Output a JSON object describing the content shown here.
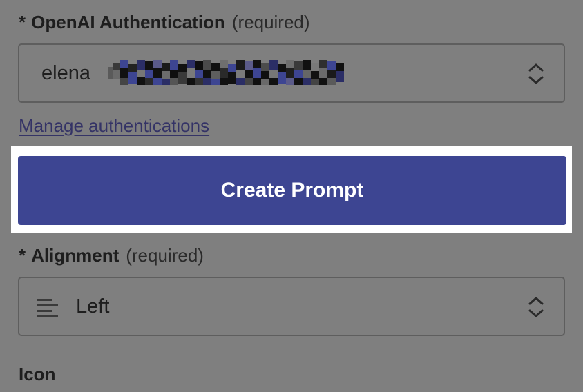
{
  "auth_field": {
    "asterisk": "*",
    "label": "OpenAI Authentication",
    "required": "(required)",
    "value": "elena"
  },
  "manage_link": "Manage authentications",
  "create_button": "Create Prompt",
  "alignment_field": {
    "asterisk": "*",
    "label": "Alignment",
    "required": "(required)",
    "value": "Left",
    "icon": "align-left-icon"
  },
  "icon_field": {
    "label": "Icon"
  },
  "colors": {
    "overlay_background": "#7f7f7f",
    "primary_button": "#3d4592",
    "link": "#343366",
    "highlight": "#ffffff"
  }
}
